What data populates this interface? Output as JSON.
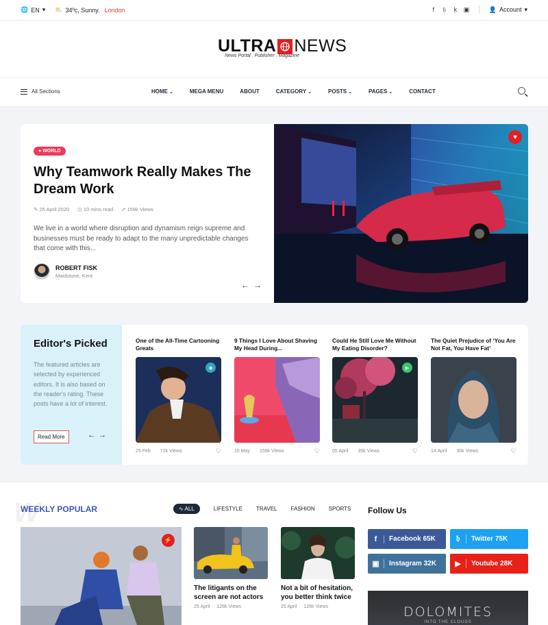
{
  "topbar": {
    "language": "EN",
    "weather_text": "34ºc, Sunny.",
    "city": "London",
    "account": "Account",
    "socials": [
      "facebook-icon",
      "twitter-icon",
      "pinterest-icon",
      "instagram-icon"
    ]
  },
  "logo": {
    "part1": "ULTRA",
    "part2": "NEWS",
    "tagline": "News Portal  .  Publisher  .  Magazine"
  },
  "nav": {
    "all_sections": "All Sections",
    "items": [
      "HOME",
      "MEGA MENU",
      "ABOUT",
      "CATEGORY",
      "POSTS",
      "PAGES",
      "CONTACT"
    ]
  },
  "hero": {
    "category": "WORLD",
    "title": "Why Teamwork Really Makes The Dream Work",
    "date": "25 April 2020",
    "read_time": "10 mins read",
    "views": "159k Views",
    "excerpt": "We live in a world where disruption and dynamism reign supreme and businesses must be ready to adapt to the many unpredictable changes that come with this...",
    "author_name": "ROBERT FISK",
    "author_location": "Maidstone, Kent"
  },
  "picked": {
    "title": "Editor's Picked",
    "description": "The featured articles are selected by experienced editors. It is also based on the reader's rating. These posts have a lot of interest.",
    "read_more": "Read More",
    "cards": [
      {
        "title": "One of the All-Time Cartooning Greats",
        "date": "25 Feb",
        "views": "72k Views"
      },
      {
        "title": "9 Things I Love About Shaving My Head During...",
        "date": "15 May",
        "views": "159k Views"
      },
      {
        "title": "Could He Still Love Me Without My Eating Disorder?",
        "date": "05 April",
        "views": "35k Views"
      },
      {
        "title": "The Quiet Prejudice of ‘You Are Not Fat, You Have Fat’",
        "date": "14 April",
        "views": "30k Views"
      }
    ]
  },
  "weekly": {
    "ghost": "W",
    "title": "WEEKLY POPULAR",
    "tabs": [
      "ALL",
      "LIFESTYLE",
      "TRAVEL",
      "FASHION",
      "SPORTS"
    ],
    "posts": [
      {
        "title": "The litigants on the screen are not actors",
        "date": "25 April",
        "views": "126k Views"
      },
      {
        "title": "Not a bit of hesitation, you better think twice",
        "date": "25 April",
        "views": "126k Views"
      }
    ]
  },
  "follow": {
    "title": "Follow Us",
    "buttons": [
      {
        "label": "Facebook 65K",
        "color": "#3b5998"
      },
      {
        "label": "Twitter 75K",
        "color": "#1da1f2"
      },
      {
        "label": "Instagram 32K",
        "color": "#3f729b"
      },
      {
        "label": "Youtube 28K",
        "color": "#e62117"
      }
    ]
  },
  "banner": {
    "title": "DOLOMITES",
    "subtitle": "INTO THE CLOUDS"
  }
}
